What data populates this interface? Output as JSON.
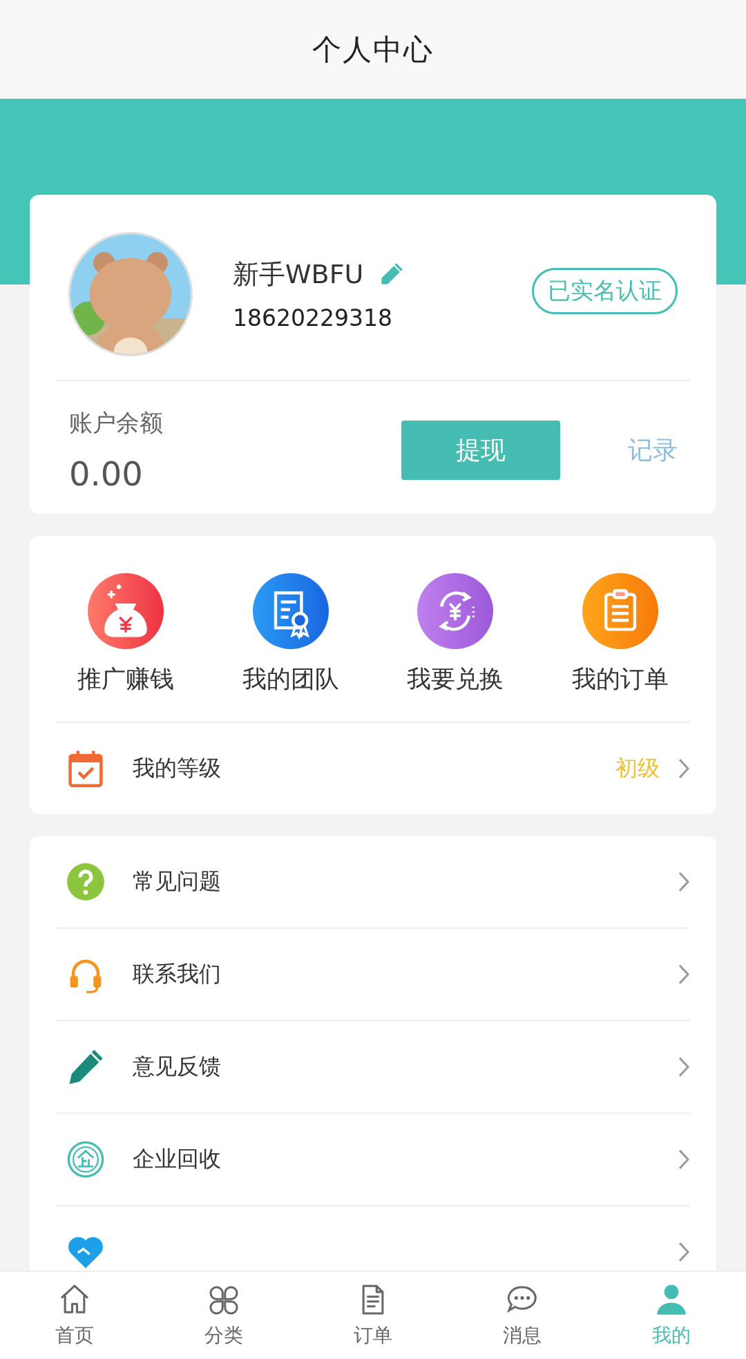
{
  "header": {
    "title": "个人中心"
  },
  "profile": {
    "name": "新手WBFU",
    "phone": "18620229318",
    "badge": "已实名认证"
  },
  "balance": {
    "label": "账户余额",
    "amount": "0.00",
    "button": "提现",
    "link": "记录"
  },
  "shortcuts": [
    {
      "kind": "promote",
      "label": "推广赚钱"
    },
    {
      "kind": "team",
      "label": "我的团队"
    },
    {
      "kind": "exchange",
      "label": "我要兑换"
    },
    {
      "kind": "orders",
      "label": "我的订单"
    }
  ],
  "level_row": {
    "label": "我的等级",
    "value": "初级"
  },
  "menu": [
    {
      "kind": "faq",
      "label": "常见问题"
    },
    {
      "kind": "contact",
      "label": "联系我们"
    },
    {
      "kind": "feedback",
      "label": "意见反馈"
    },
    {
      "kind": "enterprise",
      "label": "企业回收"
    },
    {
      "kind": "partner"
    }
  ],
  "tabs": [
    {
      "kind": "home",
      "label": "首页",
      "selected": false
    },
    {
      "kind": "category",
      "label": "分类",
      "selected": false
    },
    {
      "kind": "order",
      "label": "订单",
      "selected": false
    },
    {
      "kind": "message",
      "label": "消息",
      "selected": false
    },
    {
      "kind": "me",
      "label": "我的",
      "selected": true
    }
  ]
}
